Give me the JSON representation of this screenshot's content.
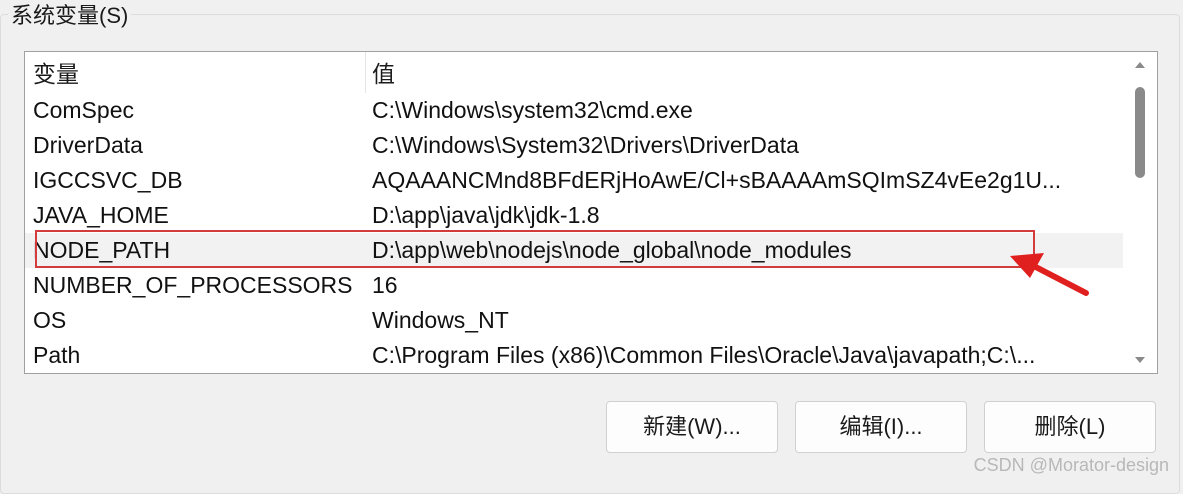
{
  "group": {
    "title": "系统变量(S)"
  },
  "table": {
    "headers": {
      "name": "变量",
      "value": "值"
    },
    "rows": [
      {
        "name": "ComSpec",
        "value": "C:\\Windows\\system32\\cmd.exe"
      },
      {
        "name": "DriverData",
        "value": "C:\\Windows\\System32\\Drivers\\DriverData"
      },
      {
        "name": "IGCCSVC_DB",
        "value": "AQAAANCMnd8BFdERjHoAwE/Cl+sBAAAAmSQImSZ4vEe2g1U..."
      },
      {
        "name": "JAVA_HOME",
        "value": "D:\\app\\java\\jdk\\jdk-1.8"
      },
      {
        "name": "NODE_PATH",
        "value": "D:\\app\\web\\nodejs\\node_global\\node_modules"
      },
      {
        "name": "NUMBER_OF_PROCESSORS",
        "value": "16"
      },
      {
        "name": "OS",
        "value": "Windows_NT"
      },
      {
        "name": "Path",
        "value": "C:\\Program Files (x86)\\Common Files\\Oracle\\Java\\javapath;C:\\..."
      }
    ],
    "highlighted_row": "NODE_PATH"
  },
  "buttons": {
    "new": "新建(W)...",
    "edit": "编辑(I)...",
    "delete": "删除(L)"
  },
  "watermark": "CSDN @Morator-design",
  "colors": {
    "annotation": "#d23c3c",
    "background": "#f0f0f0"
  },
  "icons": {
    "scroll_up": "chevron-up-icon",
    "scroll_down": "chevron-down-icon",
    "annotation": "red-arrow-icon"
  }
}
